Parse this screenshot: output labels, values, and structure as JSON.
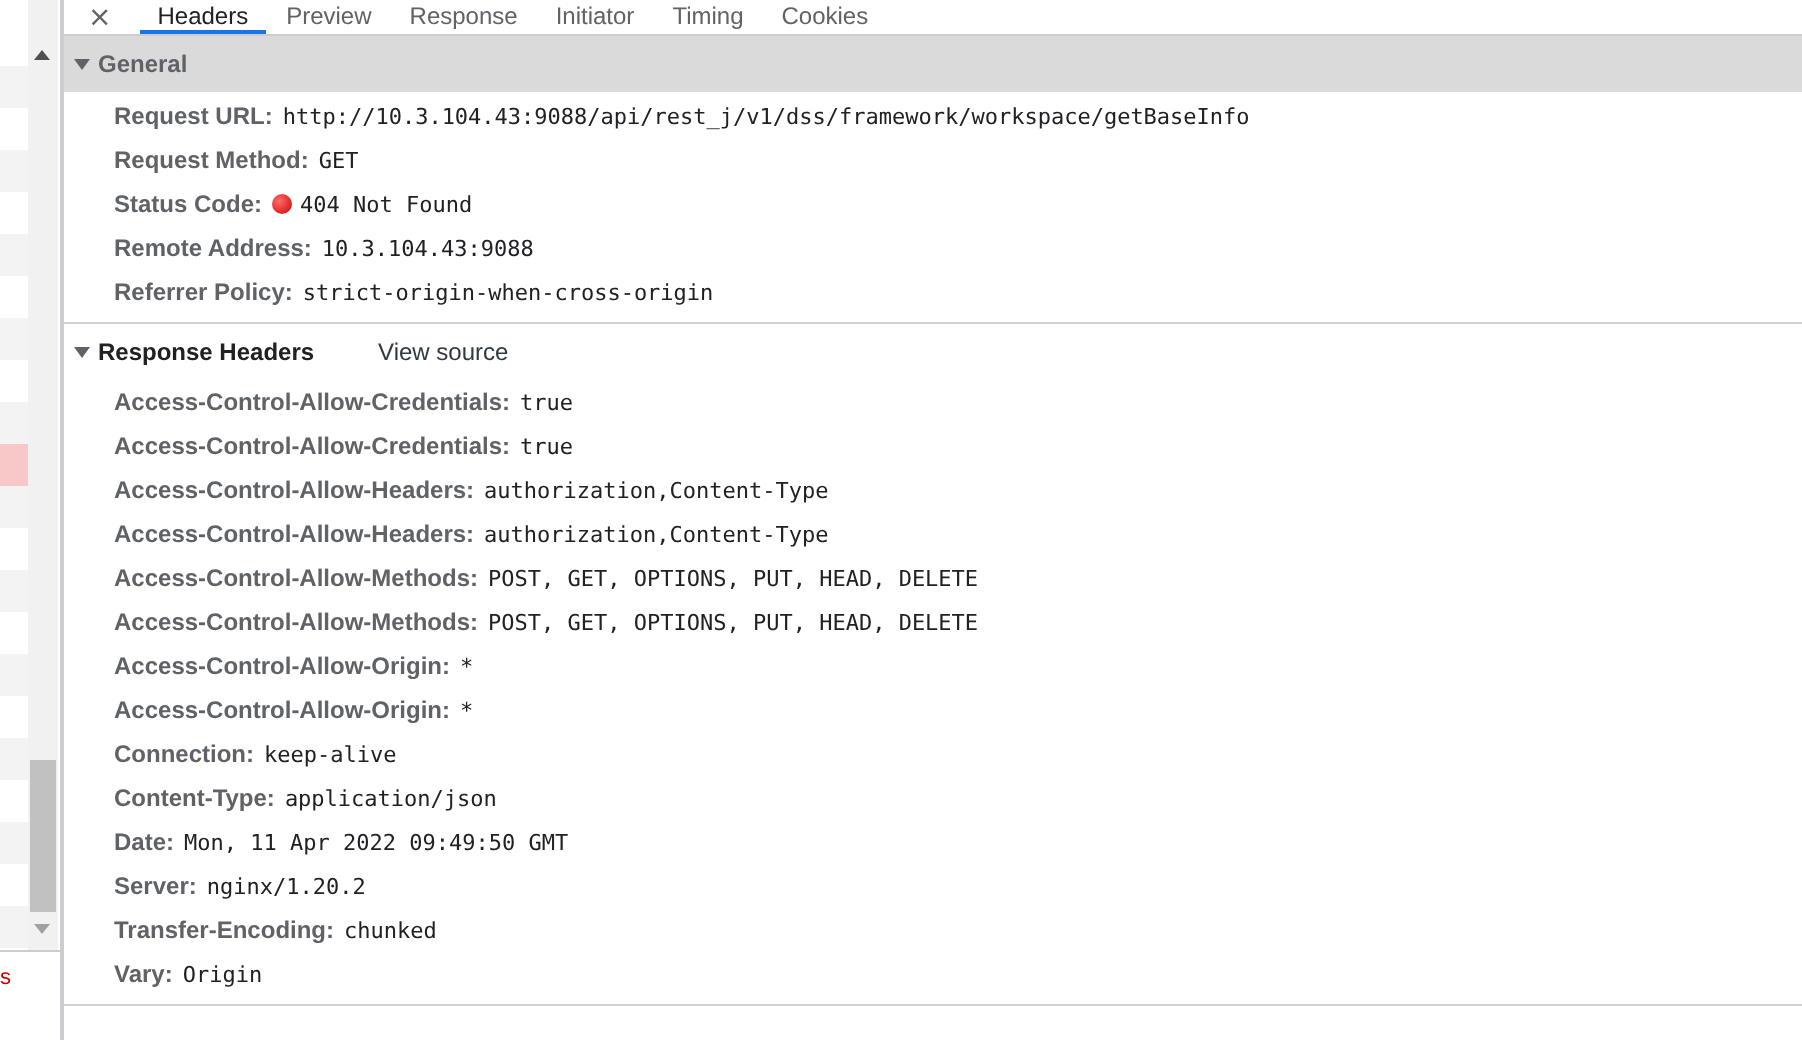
{
  "tabs": {
    "close": "×",
    "items": [
      {
        "label": "Headers",
        "selected": true
      },
      {
        "label": "Preview",
        "selected": false
      },
      {
        "label": "Response",
        "selected": false
      },
      {
        "label": "Initiator",
        "selected": false
      },
      {
        "label": "Timing",
        "selected": false
      },
      {
        "label": "Cookies",
        "selected": false
      }
    ]
  },
  "general": {
    "title": "General",
    "expanded": true,
    "fields": [
      {
        "kind": "text",
        "name": "Request URL:",
        "value": "http://10.3.104.43:9088/api/rest_j/v1/dss/framework/workspace/getBaseInfo"
      },
      {
        "kind": "text",
        "name": "Request Method:",
        "value": "GET"
      },
      {
        "kind": "status",
        "name": "Status Code:",
        "value": "404 Not Found"
      },
      {
        "kind": "text",
        "name": "Remote Address:",
        "value": "10.3.104.43:9088"
      },
      {
        "kind": "text",
        "name": "Referrer Policy:",
        "value": "strict-origin-when-cross-origin"
      }
    ]
  },
  "response_headers": {
    "title": "Response Headers",
    "expanded": true,
    "view_source": "View source",
    "fields": [
      {
        "kind": "text",
        "name": "Access-Control-Allow-Credentials:",
        "value": "true"
      },
      {
        "kind": "text",
        "name": "Access-Control-Allow-Credentials:",
        "value": "true"
      },
      {
        "kind": "text",
        "name": "Access-Control-Allow-Headers:",
        "value": "authorization,Content-Type"
      },
      {
        "kind": "text",
        "name": "Access-Control-Allow-Headers:",
        "value": "authorization,Content-Type"
      },
      {
        "kind": "text",
        "name": "Access-Control-Allow-Methods:",
        "value": "POST, GET, OPTIONS, PUT, HEAD, DELETE"
      },
      {
        "kind": "text",
        "name": "Access-Control-Allow-Methods:",
        "value": "POST, GET, OPTIONS, PUT, HEAD, DELETE"
      },
      {
        "kind": "text",
        "name": "Access-Control-Allow-Origin:",
        "value": "*"
      },
      {
        "kind": "text",
        "name": "Access-Control-Allow-Origin:",
        "value": "*"
      },
      {
        "kind": "text",
        "name": "Connection:",
        "value": "keep-alive"
      },
      {
        "kind": "text",
        "name": "Content-Type:",
        "value": "application/json"
      },
      {
        "kind": "text",
        "name": "Date:",
        "value": "Mon, 11 Apr 2022 09:49:50 GMT"
      },
      {
        "kind": "text",
        "name": "Server:",
        "value": "nginx/1.20.2"
      },
      {
        "kind": "text",
        "name": "Transfer-Encoding:",
        "value": "chunked"
      },
      {
        "kind": "text",
        "name": "Vary:",
        "value": "Origin"
      }
    ]
  },
  "request_list": {
    "footer": "s",
    "rows": [
      {
        "error": false
      },
      {
        "error": false
      },
      {
        "error": false
      },
      {
        "error": false
      },
      {
        "error": false
      },
      {
        "error": false
      },
      {
        "error": false
      },
      {
        "error": false
      },
      {
        "error": false
      },
      {
        "error": false
      },
      {
        "error": true
      },
      {
        "error": false
      },
      {
        "error": false
      },
      {
        "error": false
      },
      {
        "error": false
      },
      {
        "error": false
      },
      {
        "error": false
      },
      {
        "error": false
      },
      {
        "error": false
      },
      {
        "error": false
      },
      {
        "error": false
      },
      {
        "error": false
      }
    ]
  }
}
